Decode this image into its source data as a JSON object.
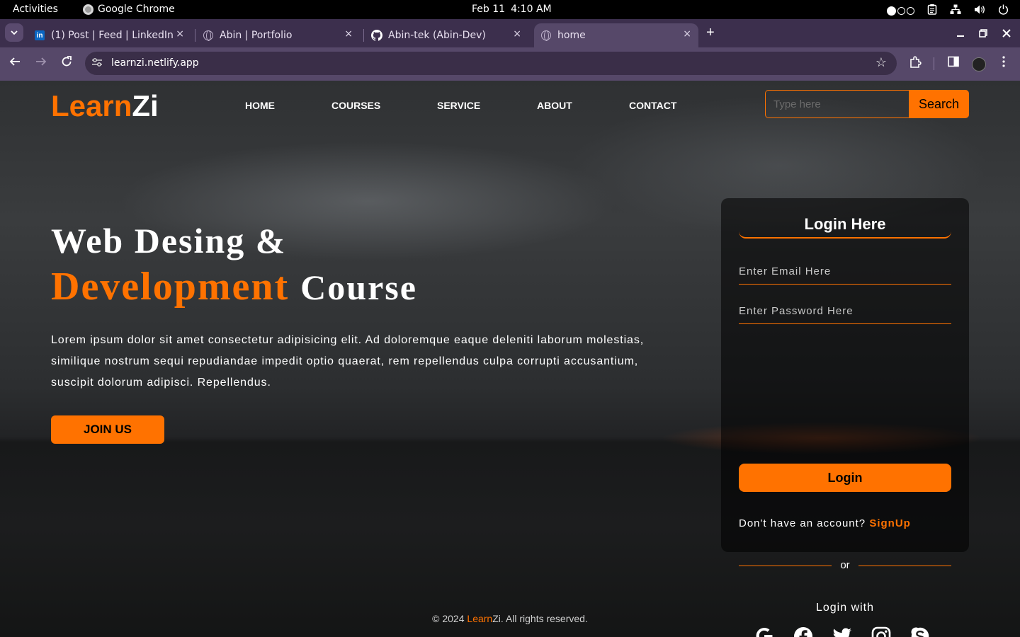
{
  "system": {
    "activities": "Activities",
    "app_name": "Google Chrome",
    "date": "Feb 11",
    "time": "4:10 AM"
  },
  "browser": {
    "tabs": [
      {
        "title": "(1) Post | Feed | LinkedIn",
        "icon": "linkedin-icon",
        "close": "×"
      },
      {
        "title": "Abin | Portfolio",
        "icon": "globe-icon",
        "close": "×"
      },
      {
        "title": "Abin-tek (Abin-Dev)",
        "icon": "github-icon",
        "close": "×"
      },
      {
        "title": "home",
        "icon": "globe-icon",
        "close": "×",
        "active": true
      }
    ],
    "new_tab": "+",
    "url": "learnzi.netlify.app"
  },
  "site": {
    "brand_a": "Learn",
    "brand_b": "Zi",
    "nav": [
      "HOME",
      "COURSES",
      "SERVICE",
      "ABOUT",
      "CONTACT"
    ],
    "search_placeholder": "Type here",
    "search_label": "Search",
    "accent": "#ff7200"
  },
  "hero": {
    "line1": "Web Desing &",
    "line2_orange": "Development",
    "line2_white": "Course",
    "text": "Lorem ipsum dolor sit amet consectetur adipisicing elit. Ad doloremque eaque deleniti laborum molestias, similique nostrum sequi repudiandae impedit optio quaerat, rem repellendus culpa corrupti accusantium, suscipit dolorum adipisci. Repellendus.",
    "cta": "JOIN US"
  },
  "login": {
    "title": "Login Here",
    "email_placeholder": "Enter Email Here",
    "password_placeholder": "Enter Password Here",
    "button": "Login",
    "signup_prompt": "Don't have an account?",
    "signup_link": "SignUp",
    "or": "or",
    "login_with": "Login with",
    "socials": [
      "google-icon",
      "facebook-icon",
      "twitter-icon",
      "instagram-icon",
      "skype-icon"
    ]
  },
  "footer": {
    "prefix": "© 2024",
    "brand_a": "Learn",
    "brand_b": "Zi",
    "suffix": ". All rights reserved."
  }
}
